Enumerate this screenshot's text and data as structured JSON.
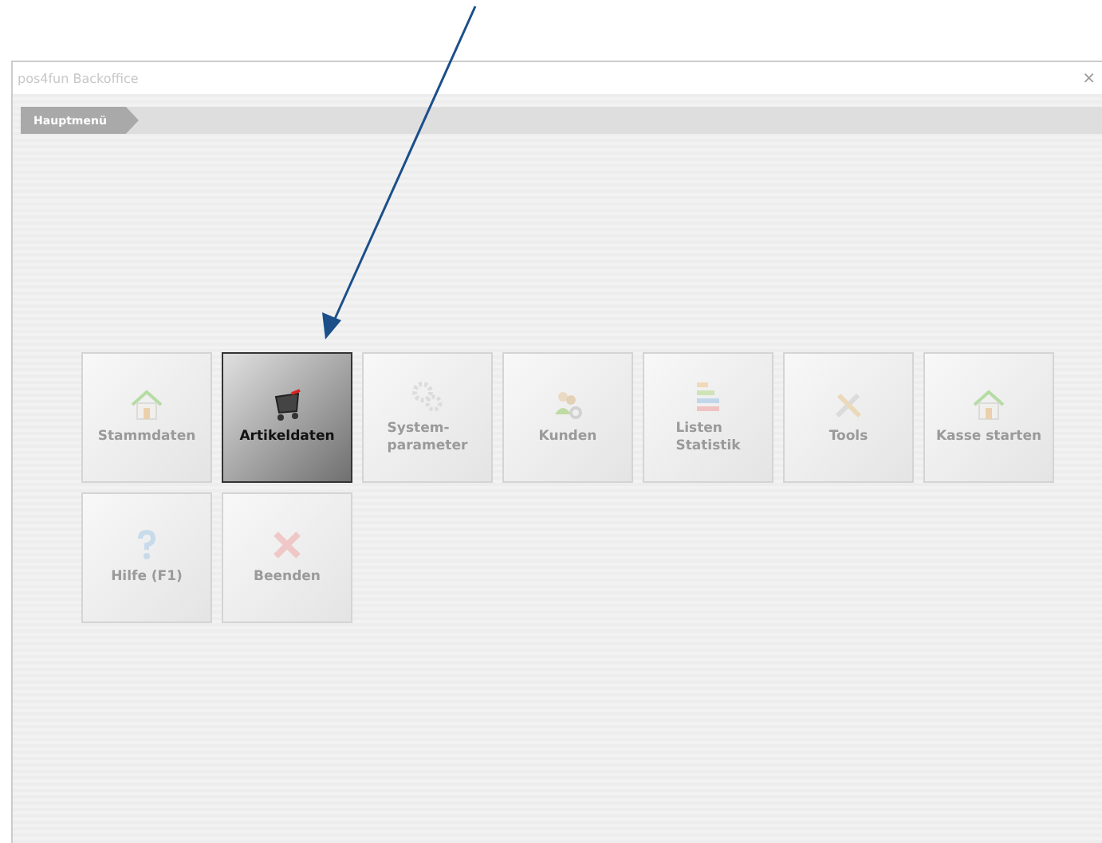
{
  "window": {
    "title": "pos4fun Backoffice",
    "close": "×"
  },
  "breadcrumb": {
    "label": "Hauptmenü"
  },
  "tiles": [
    {
      "label": "Stammdaten",
      "kind": "house",
      "selected": false
    },
    {
      "label": "Artikeldaten",
      "kind": "cart",
      "selected": true
    },
    {
      "label": "System-\nparameter",
      "kind": "gears",
      "selected": false
    },
    {
      "label": "Kunden",
      "kind": "people",
      "selected": false
    },
    {
      "label": "Listen\nStatistik",
      "kind": "bars",
      "selected": false
    },
    {
      "label": "Tools",
      "kind": "tools",
      "selected": false
    },
    {
      "label": "Kasse starten",
      "kind": "house",
      "selected": false
    },
    {
      "label": "Hilfe (F1)",
      "kind": "help",
      "selected": false
    },
    {
      "label": "Beenden",
      "kind": "cross",
      "selected": false
    }
  ],
  "annotation": {
    "kind": "arrow"
  }
}
